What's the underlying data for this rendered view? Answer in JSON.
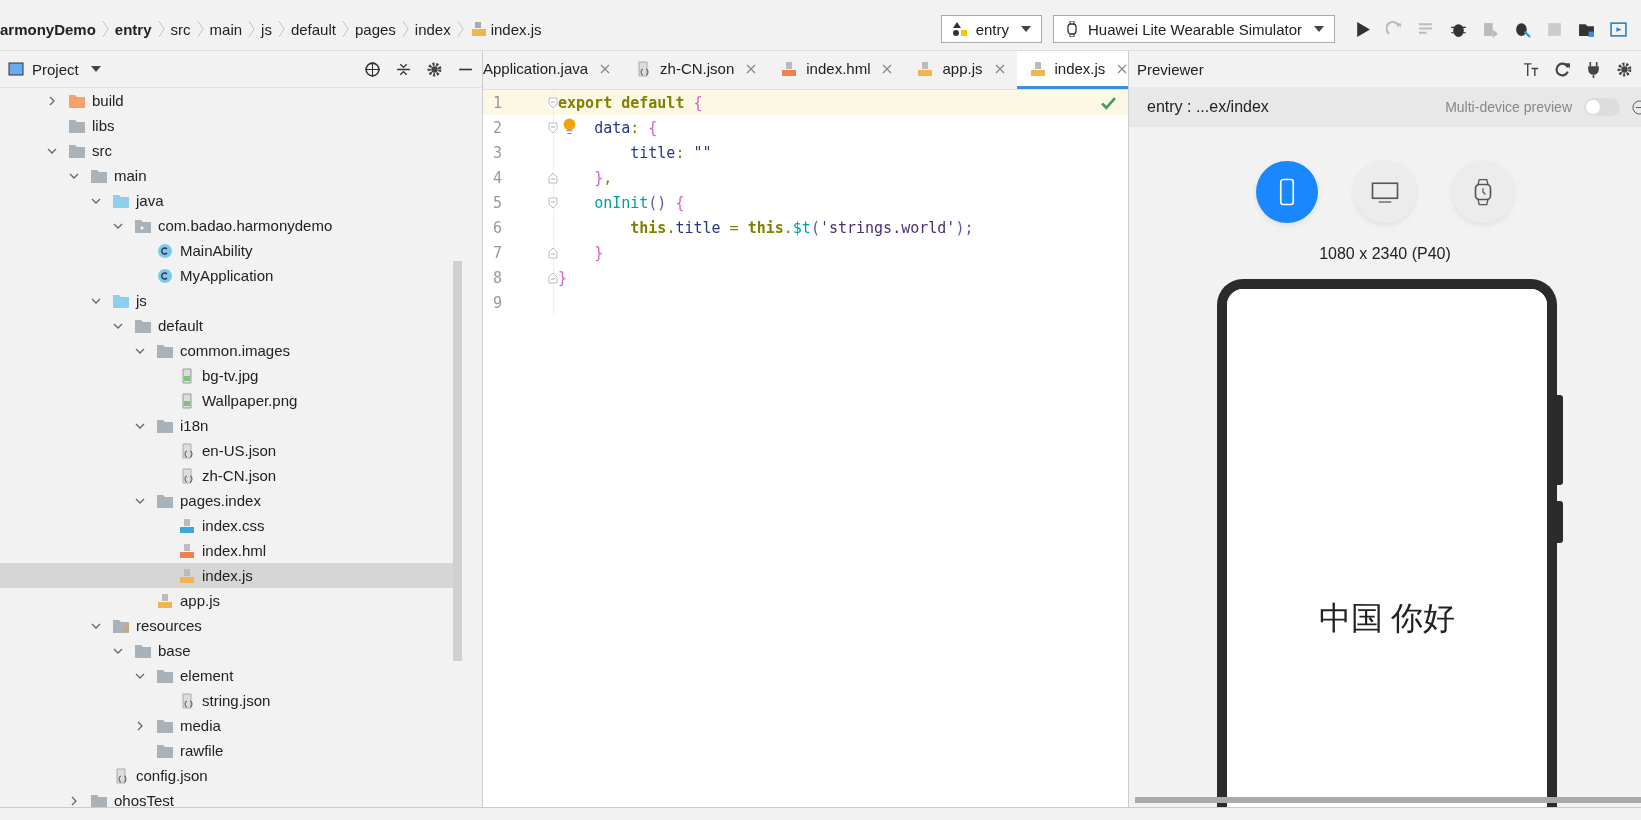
{
  "breadcrumbs": [
    {
      "label": "armonyDemo",
      "bold": true,
      "kind": "text"
    },
    {
      "label": "entry",
      "bold": true,
      "kind": "text"
    },
    {
      "label": "src",
      "bold": false,
      "kind": "text"
    },
    {
      "label": "main",
      "bold": false,
      "kind": "text"
    },
    {
      "label": "js",
      "bold": false,
      "kind": "text"
    },
    {
      "label": "default",
      "bold": false,
      "kind": "text"
    },
    {
      "label": "pages",
      "bold": false,
      "kind": "text"
    },
    {
      "label": "index",
      "bold": false,
      "kind": "text"
    },
    {
      "label": "index.js",
      "bold": false,
      "kind": "js"
    }
  ],
  "toolbar": {
    "run_config": "entry",
    "device": "Huawei Lite Wearable Simulator"
  },
  "project": {
    "title": "Project",
    "tree": [
      {
        "label": "build",
        "kind": "folder-orange",
        "expanded": false,
        "selected": false
      },
      {
        "label": "libs",
        "kind": "folder",
        "selected": false
      },
      {
        "label": "src",
        "kind": "folder",
        "expanded": true,
        "selected": false,
        "children": [
          {
            "label": "main",
            "kind": "folder",
            "expanded": true,
            "selected": false,
            "children": [
              {
                "label": "java",
                "kind": "folder-blue",
                "expanded": true,
                "selected": false,
                "children": [
                  {
                    "label": "com.badao.harmonydemo",
                    "kind": "package",
                    "expanded": true,
                    "selected": false,
                    "children": [
                      {
                        "label": "MainAbility",
                        "kind": "class",
                        "selected": false
                      },
                      {
                        "label": "MyApplication",
                        "kind": "class",
                        "selected": false
                      }
                    ]
                  }
                ]
              },
              {
                "label": "js",
                "kind": "folder-blue",
                "expanded": true,
                "selected": false,
                "children": [
                  {
                    "label": "default",
                    "kind": "folder",
                    "expanded": true,
                    "selected": false,
                    "children": [
                      {
                        "label": "common.images",
                        "kind": "folder",
                        "expanded": true,
                        "selected": false,
                        "children": [
                          {
                            "label": "bg-tv.jpg",
                            "kind": "image",
                            "selected": false
                          },
                          {
                            "label": "Wallpaper.png",
                            "kind": "image",
                            "selected": false
                          }
                        ]
                      },
                      {
                        "label": "i18n",
                        "kind": "folder",
                        "expanded": true,
                        "selected": false,
                        "children": [
                          {
                            "label": "en-US.json",
                            "kind": "json",
                            "selected": false
                          },
                          {
                            "label": "zh-CN.json",
                            "kind": "json",
                            "selected": false
                          }
                        ]
                      },
                      {
                        "label": "pages.index",
                        "kind": "folder",
                        "expanded": true,
                        "selected": false,
                        "children": [
                          {
                            "label": "index.css",
                            "kind": "css",
                            "selected": false
                          },
                          {
                            "label": "index.hml",
                            "kind": "hml",
                            "selected": false
                          },
                          {
                            "label": "index.js",
                            "kind": "js",
                            "selected": true
                          }
                        ]
                      },
                      {
                        "label": "app.js",
                        "kind": "js",
                        "selected": false
                      }
                    ]
                  }
                ]
              },
              {
                "label": "resources",
                "kind": "resources",
                "expanded": true,
                "selected": false,
                "children": [
                  {
                    "label": "base",
                    "kind": "folder",
                    "expanded": true,
                    "selected": false,
                    "children": [
                      {
                        "label": "element",
                        "kind": "folder",
                        "expanded": true,
                        "selected": false,
                        "children": [
                          {
                            "label": "string.json",
                            "kind": "json",
                            "selected": false
                          }
                        ]
                      },
                      {
                        "label": "media",
                        "kind": "folder",
                        "expanded": false,
                        "selected": false
                      },
                      {
                        "label": "rawfile",
                        "kind": "folder",
                        "selected": false
                      }
                    ]
                  }
                ]
              },
              {
                "label": "config.json",
                "kind": "json",
                "selected": false
              }
            ]
          },
          {
            "label": "ohosTest",
            "kind": "folder",
            "expanded": false,
            "selected": false
          }
        ]
      }
    ]
  },
  "editor": {
    "tabs": [
      {
        "label": "Application.java",
        "kind": "java",
        "selected": false
      },
      {
        "label": "zh-CN.json",
        "kind": "json",
        "selected": false
      },
      {
        "label": "index.hml",
        "kind": "hml",
        "selected": false
      },
      {
        "label": "app.js",
        "kind": "js",
        "selected": false
      },
      {
        "label": "index.js",
        "kind": "js",
        "selected": true
      }
    ],
    "lines": [
      {
        "number": "1",
        "current": true,
        "fold_start": true,
        "fold_end": false,
        "hint": false,
        "tokens": [
          {
            "text": "export default ",
            "kind": "kw"
          },
          {
            "text": "{",
            "kind": "brace"
          }
        ]
      },
      {
        "number": "2",
        "current": false,
        "fold_start": true,
        "fold_end": false,
        "hint": true,
        "tokens": [
          {
            "text": "    data",
            "kind": "prop"
          },
          {
            "text": ": ",
            "kind": "punc"
          },
          {
            "text": "{",
            "kind": "brace"
          }
        ]
      },
      {
        "number": "3",
        "current": false,
        "fold_start": false,
        "fold_end": false,
        "hint": false,
        "tokens": [
          {
            "text": "        title",
            "kind": "prop"
          },
          {
            "text": ": ",
            "kind": "punc"
          },
          {
            "text": "\"\"",
            "kind": "str"
          }
        ]
      },
      {
        "number": "4",
        "current": false,
        "fold_start": false,
        "fold_end": true,
        "hint": false,
        "tokens": [
          {
            "text": "    }",
            "kind": "brace"
          },
          {
            "text": ",",
            "kind": "punc"
          }
        ]
      },
      {
        "number": "5",
        "current": false,
        "fold_start": true,
        "fold_end": false,
        "hint": false,
        "tokens": [
          {
            "text": "    onInit",
            "kind": "fn"
          },
          {
            "text": "() ",
            "kind": "paren"
          },
          {
            "text": "{",
            "kind": "brace"
          }
        ]
      },
      {
        "number": "6",
        "current": false,
        "fold_start": false,
        "fold_end": false,
        "hint": false,
        "tokens": [
          {
            "text": "        this",
            "kind": "kw"
          },
          {
            "text": ".",
            "kind": "punc"
          },
          {
            "text": "title ",
            "kind": "prop"
          },
          {
            "text": "= ",
            "kind": "punc"
          },
          {
            "text": "this",
            "kind": "kw"
          },
          {
            "text": ".",
            "kind": "punc"
          },
          {
            "text": "$t",
            "kind": "fn"
          },
          {
            "text": "(",
            "kind": "paren"
          },
          {
            "text": "'strings.world'",
            "kind": "str"
          },
          {
            "text": ");",
            "kind": "paren"
          }
        ]
      },
      {
        "number": "7",
        "current": false,
        "fold_start": false,
        "fold_end": true,
        "hint": false,
        "tokens": [
          {
            "text": "    }",
            "kind": "brace"
          }
        ]
      },
      {
        "number": "8",
        "current": false,
        "fold_start": false,
        "fold_end": true,
        "hint": false,
        "tokens": [
          {
            "text": "}",
            "kind": "brace"
          }
        ]
      },
      {
        "number": "9",
        "current": false,
        "fold_start": false,
        "fold_end": false,
        "hint": false
      }
    ]
  },
  "previewer": {
    "title": "Previewer",
    "path": "entry : ...ex/index",
    "multi_device": {
      "label": "Multi-device preview",
      "on": false
    },
    "devices": [
      {
        "kind": "phone",
        "selected": true
      },
      {
        "kind": "tv",
        "selected": false
      },
      {
        "kind": "watch",
        "selected": false
      }
    ],
    "resolution": "1080 x 2340 (P40)",
    "screen_text": "中国 你好"
  }
}
